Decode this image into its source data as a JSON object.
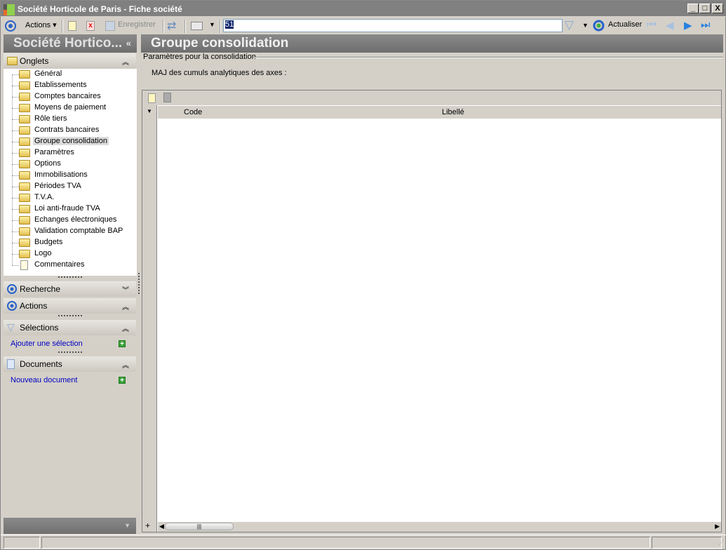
{
  "window": {
    "title": "Société Horticole de Paris -  Fiche société",
    "minimize": "_",
    "maximize": "□",
    "close": "X"
  },
  "toolbar": {
    "actions_label": "Actions",
    "save_label": "Enregistrer",
    "record_input": "51",
    "refresh_label": "Actualiser"
  },
  "left": {
    "title": "Société Hortico...",
    "collapse": "«",
    "tabs_header": "Onglets",
    "tabs": [
      "Général",
      "Etablissements",
      "Comptes bancaires",
      "Moyens de paiement",
      "Rôle tiers",
      "Contrats bancaires",
      "Groupe consolidation",
      "Paramètres",
      "Options",
      "Immobilisations",
      "Périodes TVA",
      "T.V.A.",
      "Loi anti-fraude TVA",
      "Echanges électroniques",
      "Validation comptable BAP",
      "Budgets",
      "Logo",
      "Commentaires"
    ],
    "selected_tab": "Groupe consolidation",
    "search_header": "Recherche",
    "actions_header": "Actions",
    "selections_header": "Sélections",
    "add_selection": "Ajouter une sélection",
    "documents_header": "Documents",
    "new_document": "Nouveau document"
  },
  "main": {
    "title": "Groupe consolidation",
    "group_label": "Paramètres pour la consolidation",
    "maj_label": "MAJ des cumuls analytiques des axes :",
    "grid": {
      "columns": [
        "Code",
        "Libellé"
      ],
      "rows": []
    }
  }
}
